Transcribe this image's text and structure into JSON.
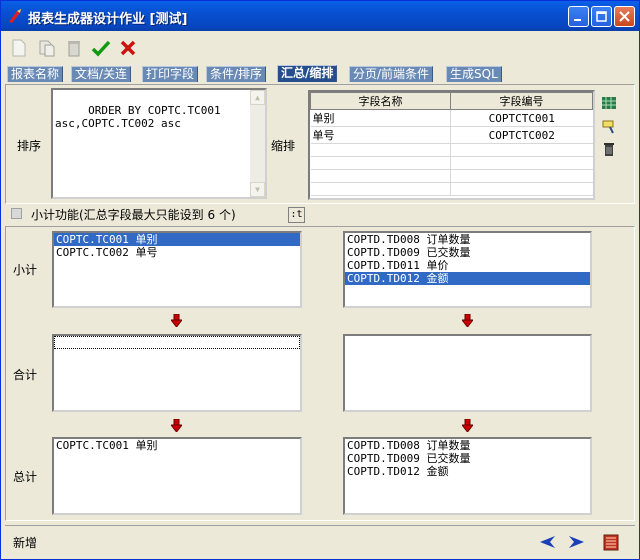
{
  "window": {
    "title": "报表生成器设计作业 [测试]"
  },
  "tabs": [
    {
      "label": "报表名称"
    },
    {
      "label": "文档/关连"
    },
    {
      "label": "打印字段"
    },
    {
      "label": "条件/排序"
    },
    {
      "label": "汇总/缩排"
    },
    {
      "label": "分页/前端条件"
    },
    {
      "label": "生成SQL"
    }
  ],
  "sort": {
    "label": "排序",
    "text": " ORDER BY COPTC.TC001\nasc,COPTC.TC002 asc"
  },
  "indent": {
    "label": "缩排",
    "columns": [
      "字段名称",
      "字段编号"
    ],
    "rows": [
      {
        "name": "单别",
        "code": "COPTCTC001"
      },
      {
        "name": "单号",
        "code": "COPTCTC002"
      }
    ]
  },
  "subtotal_func": {
    "label": "小计功能(汇总字段最大只能设到 6 个)",
    "button_label": ":t"
  },
  "groups": {
    "subtotal_label": "小计",
    "total_label": "合计",
    "grand_label": "总计",
    "subtotal_left": [
      "COPTC.TC001 单别",
      "COPTC.TC002 单号"
    ],
    "subtotal_right": [
      "COPTD.TD008 订单数量",
      "COPTD.TD009 已交数量",
      "COPTD.TD011 单价",
      "COPTD.TD012 金额"
    ],
    "grand_left": [
      "COPTC.TC001 单别"
    ],
    "grand_right": [
      "COPTD.TD008 订单数量",
      "COPTD.TD009 已交数量",
      "COPTD.TD012 金额"
    ]
  },
  "status": {
    "text": "新增"
  },
  "colors": {
    "accent": "#316AC5",
    "tab": "#6A8AB6",
    "arrow": "#CC0000"
  }
}
